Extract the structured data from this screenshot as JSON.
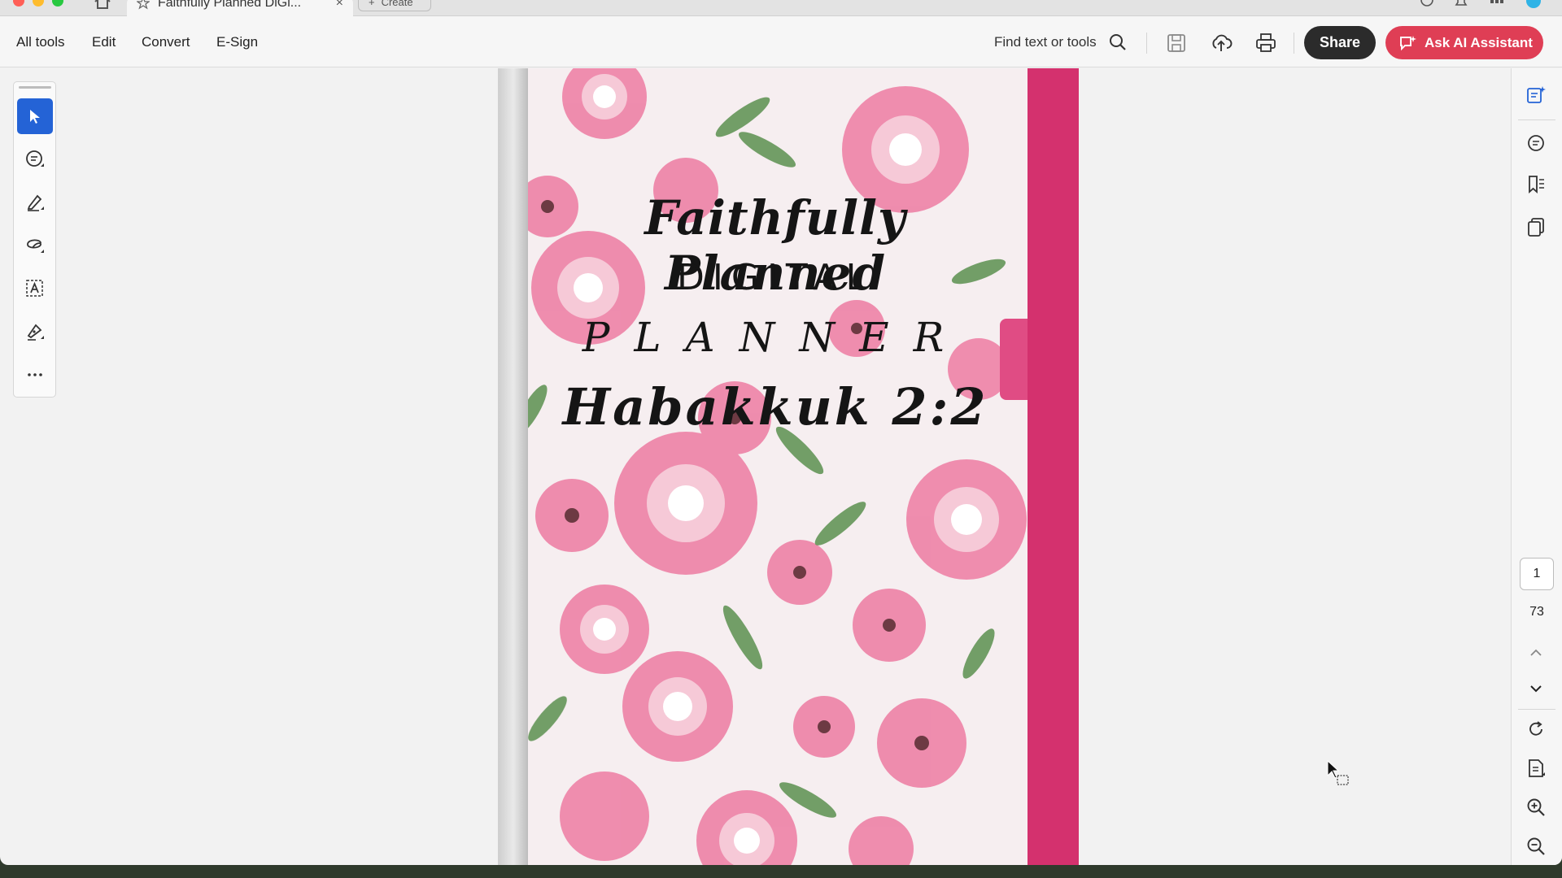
{
  "window": {
    "tab_title": "Faithfully Planned DiGi...",
    "tab_close": "×",
    "create_tab": "Create",
    "create_plus": "+"
  },
  "menu": {
    "all_tools": "All tools",
    "edit": "Edit",
    "convert": "Convert",
    "esign": "E-Sign",
    "find_label": "Find text or tools",
    "share_label": "Share",
    "ai_label": "Ask AI Assistant"
  },
  "tools": [
    "select-tool-icon",
    "add-comment-icon",
    "highlight-pen-icon",
    "lasso-draw-icon",
    "text-select-icon",
    "sign-pen-icon",
    "more-tools-icon"
  ],
  "document": {
    "title_line1": "Faithfully Planned",
    "title_line2": "DIGITAL",
    "title_line3": "PLANNER",
    "title_line4": "Habakkuk 2:2"
  },
  "navigation": {
    "current_page": "1",
    "total_pages": "73"
  },
  "colors": {
    "accent_blue": "#2463d6",
    "share_bg": "#2b2b2b",
    "ai_bg": "#df3e55",
    "cover_pink": "#d4316e"
  }
}
